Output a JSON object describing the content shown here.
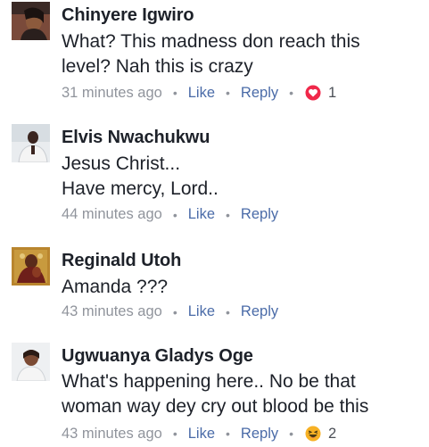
{
  "comments": [
    {
      "author": "Chinyere Igwiro",
      "lines": [
        "What? This madness don reach this",
        "level? Nah this is crazy"
      ],
      "time": "31 minutes ago",
      "like": "Like",
      "reply": "Reply",
      "reaction": {
        "icon": "love-reaction-icon",
        "color": "#f0284a",
        "count": "1"
      }
    },
    {
      "author": "Elvis Nwachukwu",
      "lines": [
        "Jesus Christ...",
        "Have mercy,  Lord.."
      ],
      "time": "44 minutes ago",
      "like": "Like",
      "reply": "Reply"
    },
    {
      "author": "Reginald Utoh",
      "lines": [
        "Amanda ???"
      ],
      "time": "43 minutes ago",
      "like": "Like",
      "reply": "Reply"
    },
    {
      "author": "Ugwuanya Gladys Oge",
      "lines": [
        "What's happening here.. No be that",
        "woman way dey cry out blood be this"
      ],
      "time": "43 minutes ago",
      "like": "Like",
      "reply": "Reply",
      "reaction": {
        "icon": "haha-reaction-icon",
        "color": "#f7b125",
        "count": "2"
      }
    }
  ],
  "dot": "•"
}
